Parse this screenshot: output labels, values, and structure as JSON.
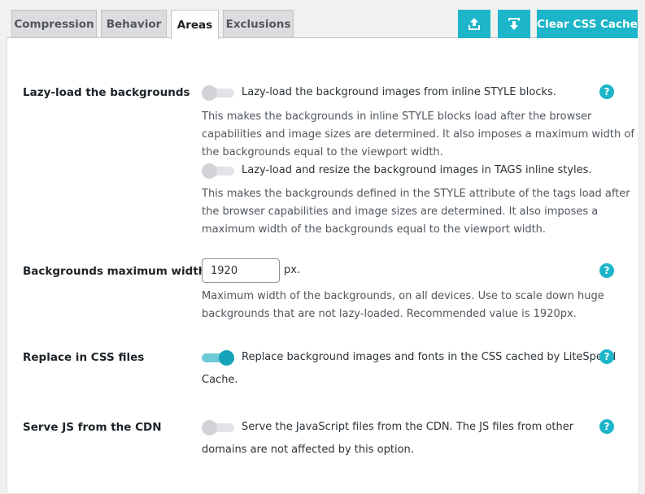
{
  "tabs": [
    {
      "label": "Compression"
    },
    {
      "label": "Behavior"
    },
    {
      "label": "Areas"
    },
    {
      "label": "Exclusions"
    }
  ],
  "toolbar": {
    "export_icon": "upload-icon",
    "import_icon": "download-icon",
    "clear_cache_label": "Clear CSS Cache"
  },
  "colors": {
    "accent": "#1cb5c9"
  },
  "settings": {
    "lazy_load": {
      "label": "Lazy-load the backgrounds",
      "option1": {
        "text": "Lazy-load the background images from inline STYLE blocks.",
        "enabled": false,
        "desc_lines": [
          "This makes the backgrounds in inline STYLE blocks load after the browser",
          "capabilities and image sizes are determined. It also imposes a maximum width of",
          "the backgrounds equal to the viewport width."
        ]
      },
      "option2": {
        "text": "Lazy-load and resize the background images in TAGS inline styles.",
        "enabled": false,
        "desc_lines": [
          "This makes the backgrounds defined in the STYLE attribute of the tags load after",
          "the browser capabilities and image sizes are determined. It also imposes a",
          "maximum width of the backgrounds equal to the viewport width."
        ]
      },
      "help": "?"
    },
    "max_width": {
      "label": "Backgrounds maximum width",
      "value": "1920",
      "unit": "px.",
      "desc_lines": [
        "Maximum width of the backgrounds, on all devices. Use to scale down huge",
        "backgrounds that are not lazy-loaded. Recommended value is 1920px."
      ],
      "help": "?"
    },
    "replace_css": {
      "label": "Replace in CSS files",
      "enabled": true,
      "text_lines": [
        "Replace background images and fonts in the CSS cached by LiteSpeed",
        "Cache."
      ],
      "help": "?"
    },
    "serve_js": {
      "label": "Serve JS from the CDN",
      "enabled": false,
      "text_lines": [
        "Serve the JavaScript files from the CDN. The JS files from other",
        "domains are not affected by this option."
      ],
      "help": "?"
    }
  }
}
